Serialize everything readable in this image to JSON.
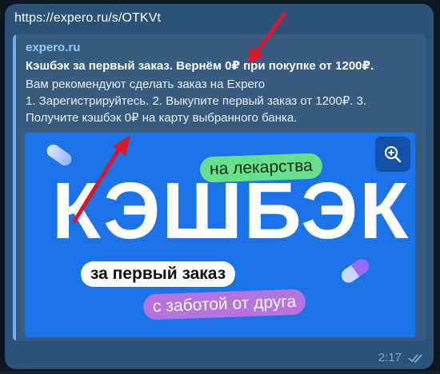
{
  "message": {
    "url": "https://expero.ru/s/OTKVt",
    "time": "2:17",
    "status_icon": "double-check-icon"
  },
  "preview": {
    "site_name": "expero.ru",
    "title": "Кэшбэк за первый заказ. Вернём 0₽ при покупке от 1200₽.",
    "description_lines": [
      "Вам рекомендуют сделать заказ на Expero",
      "1. Зарегистрируйтесь. 2. Выкупите первый заказ от 1200₽. 3.",
      "Получите кэшбэк 0₽ на карту выбранного банка."
    ],
    "accent_color": "#6ab3f3"
  },
  "banner": {
    "headline": "КЭШБЭК",
    "tag_top": "на лекарства",
    "tag_middle": "за первый заказ",
    "tag_bottom": "с заботой от друга",
    "zoom_icon": "zoom-in-icon",
    "background_color": "#1a73e8"
  },
  "annotations": {
    "arrow_color": "#d9192b"
  }
}
